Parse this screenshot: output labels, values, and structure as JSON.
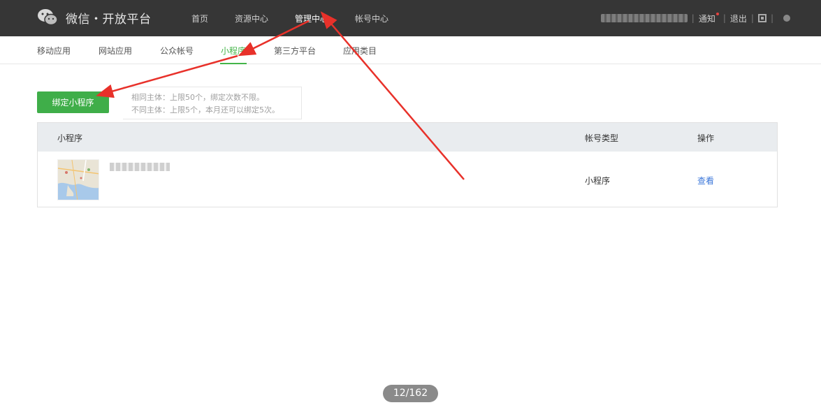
{
  "header": {
    "brand": "微信・开放平台",
    "nav": [
      {
        "label": "首页",
        "active": false
      },
      {
        "label": "资源中心",
        "active": false
      },
      {
        "label": "管理中心",
        "active": true
      },
      {
        "label": "帐号中心",
        "active": false
      }
    ],
    "user": {
      "notice_label": "通知",
      "logout_label": "退出"
    }
  },
  "subnav": [
    {
      "label": "移动应用",
      "active": false
    },
    {
      "label": "网站应用",
      "active": false
    },
    {
      "label": "公众帐号",
      "active": false
    },
    {
      "label": "小程序",
      "active": true
    },
    {
      "label": "第三方平台",
      "active": false
    },
    {
      "label": "应用类目",
      "active": false
    }
  ],
  "bind_button": "绑定小程序",
  "tips": {
    "line1": "相同主体：上限50个，绑定次数不限。",
    "line2": "不同主体：上限5个，本月还可以绑定5次。"
  },
  "table": {
    "headers": {
      "name": "小程序",
      "type": "帐号类型",
      "action": "操作"
    },
    "rows": [
      {
        "type": "小程序",
        "action": "查看"
      }
    ]
  },
  "pager": "12/162",
  "colors": {
    "topbar": "#363636",
    "accent_green": "#44b549",
    "button_green": "#3fae49",
    "link_blue": "#3a76d9",
    "annotation_red": "#e8312a"
  },
  "annotations": {
    "type": "red-arrows",
    "count": 3
  }
}
